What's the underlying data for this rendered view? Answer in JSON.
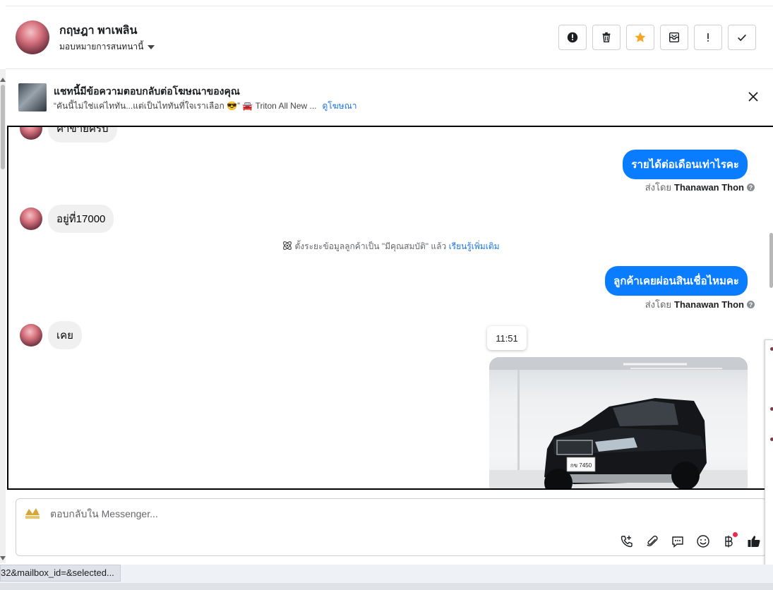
{
  "header": {
    "name": "กฤษฎา พาเพลิน",
    "assign_label": "มอบหมายการสนทนานี้"
  },
  "ad": {
    "title": "แชทนี้มีข้อความตอบกลับต่อโฆษณาของคุณ",
    "snippet": "“คันนี้ไม่ใช่แค่ไททัน...แต่เป็นไททันที่ใจเราเลือก 😎” 🚘 Triton All New ...",
    "link": "ดูโฆษณา"
  },
  "chat": {
    "partial_top_text": "ค่าขายครับ",
    "messages": [
      {
        "dir": "out",
        "text": "รายได้ต่อเดือนเท่าไรคะ"
      },
      {
        "dir": "in",
        "text": "อยู่ที่17000"
      },
      {
        "dir": "out",
        "text": "ลูกค้าเคยผ่อนสินเชื่อไหมคะ"
      },
      {
        "dir": "in",
        "text": "เคย"
      }
    ],
    "sent_by_prefix": "ส่งโดย",
    "sent_by_name": "Thanawan Thon",
    "system_text": "ตั้งระยะข้อมูลลูกค้าเป็น \"มีคุณสมบัติ\" แล้ว",
    "system_link": "เรียนรู้เพิ่มเติม",
    "tooltip_time": "11:51",
    "plate_text": "กข 7450"
  },
  "composer": {
    "placeholder": "ตอบกลับใน Messenger..."
  },
  "status_bar": {
    "url_fragment": "32&mailbox_id=&selected..."
  },
  "colors": {
    "accent": "#0a7cff",
    "link": "#1b74e4",
    "star": "#f5a623",
    "notification": "#f02849"
  },
  "icons": [
    "alert-circle-icon",
    "trash-icon",
    "star-icon",
    "mail-archive-icon",
    "exclamation-icon",
    "check-icon",
    "close-icon",
    "atom-icon",
    "phone-add-icon",
    "paperclip-icon",
    "chat-bubble-icon",
    "emoji-icon",
    "baht-icon",
    "thumbs-up-icon"
  ]
}
